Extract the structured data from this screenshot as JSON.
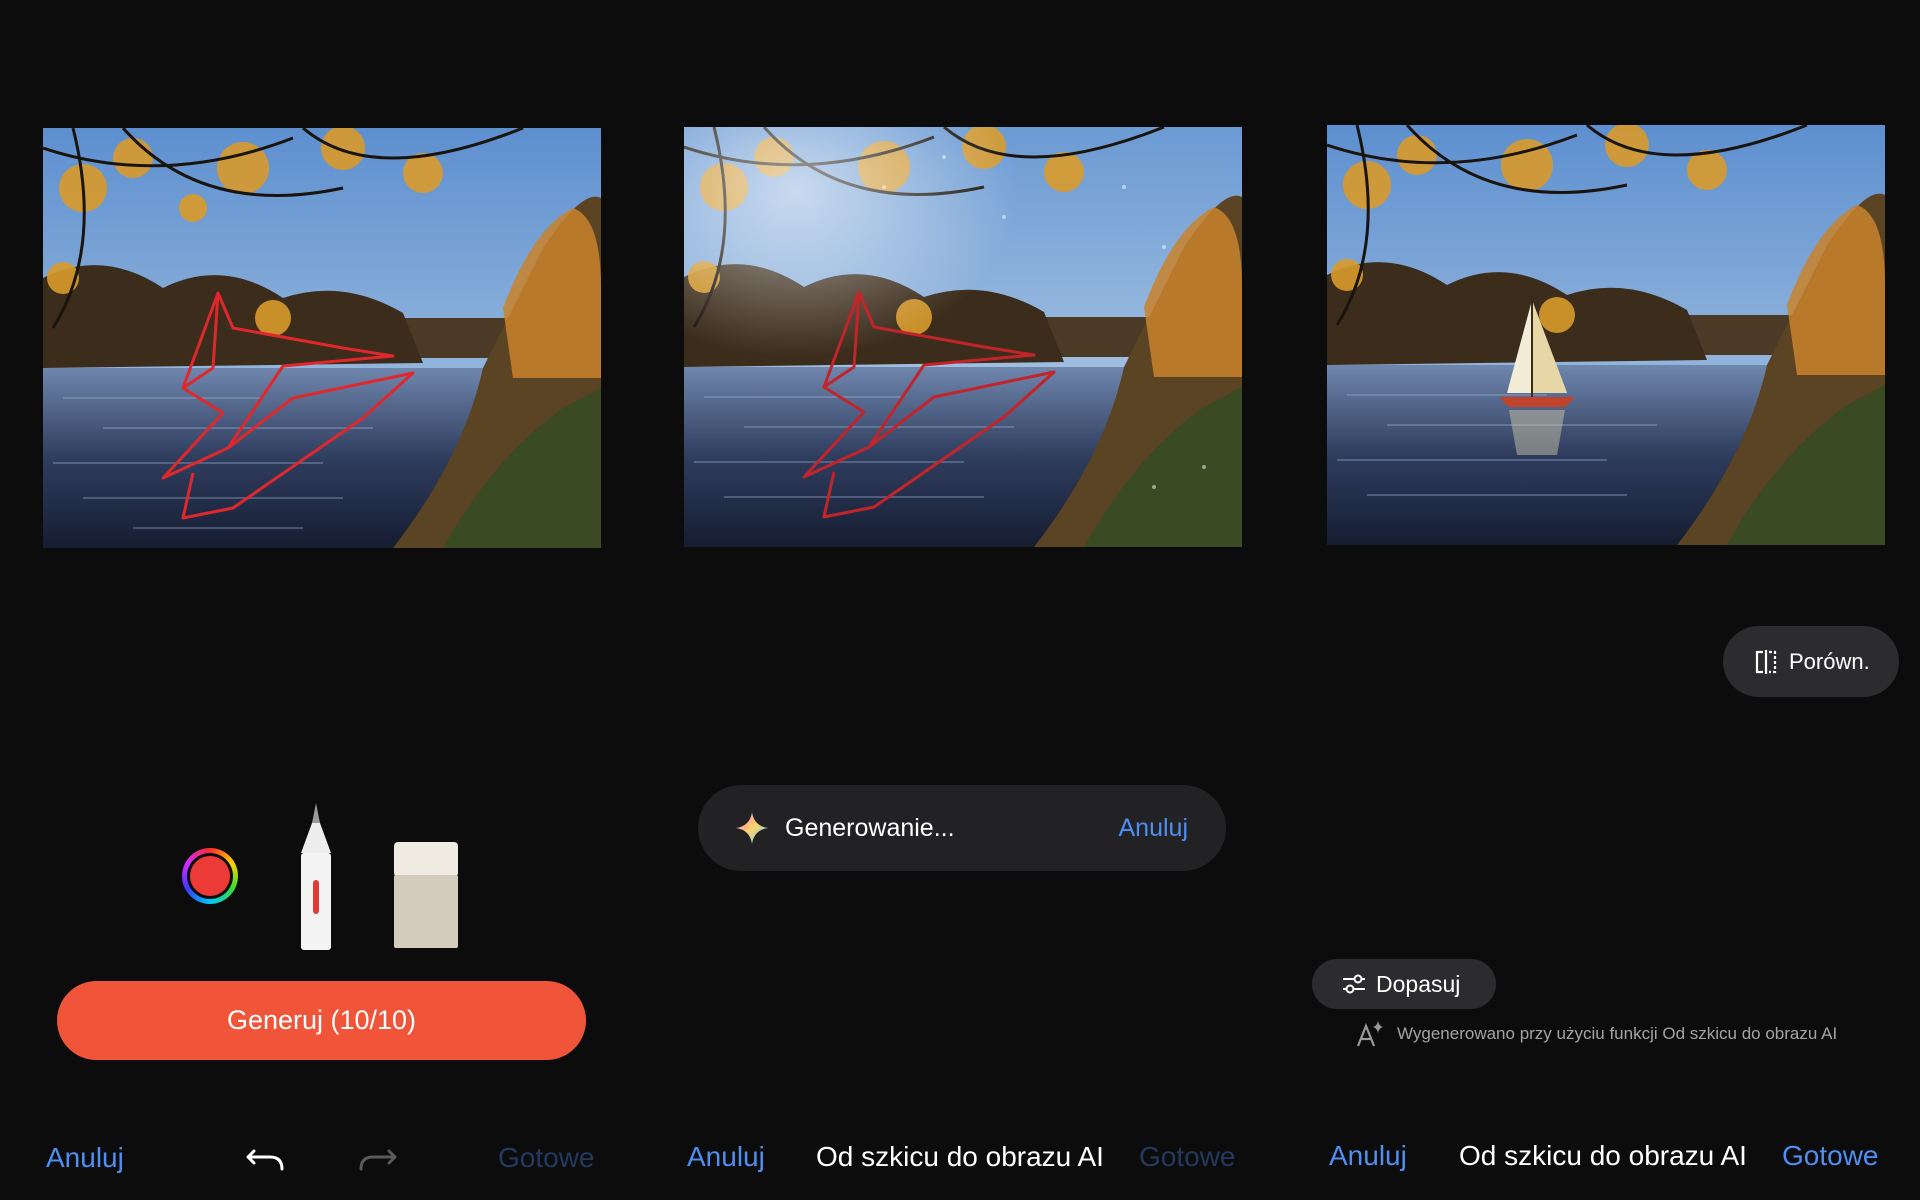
{
  "colors": {
    "background": "#0c0c0c",
    "accent_blue": "#4f8ef2",
    "disabled_blue": "#24395e",
    "generate_button": "#f0553a",
    "sketch_stroke": "#e0282c",
    "pill_background": "#2c2c2e"
  },
  "panel_left": {
    "tools": {
      "color_picker_icon": "color-wheel-icon",
      "pen_icon": "pen-icon",
      "eraser_icon": "eraser-icon"
    },
    "generate_label": "Generuj (10/10)",
    "bottom_bar": {
      "cancel_label": "Anuluj",
      "undo_icon": "undo-icon",
      "redo_icon": "redo-icon",
      "done_label": "Gotowe"
    }
  },
  "panel_middle": {
    "progress": {
      "icon": "sparkle-icon",
      "status_label": "Generowanie...",
      "cancel_label": "Anuluj"
    },
    "bottom_bar": {
      "cancel_label": "Anuluj",
      "title": "Od szkicu do obrazu AI",
      "done_label": "Gotowe"
    }
  },
  "panel_right": {
    "compare_label": "Porówn.",
    "compare_icon": "compare-icon",
    "adjust_label": "Dopasuj",
    "adjust_icon": "sliders-icon",
    "ai_note": "Wygenerowano przy użyciu funkcji Od szkicu do obrazu AI",
    "ai_note_icon": "ai-sparkle-icon",
    "bottom_bar": {
      "cancel_label": "Anuluj",
      "title": "Od szkicu do obrazu AI",
      "done_label": "Gotowe"
    }
  }
}
